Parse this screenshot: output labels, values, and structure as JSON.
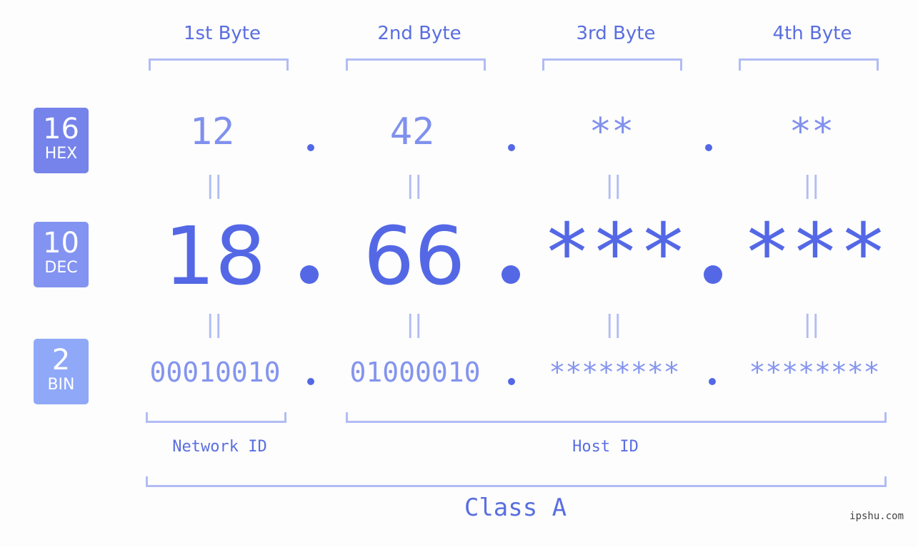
{
  "bytes": [
    {
      "title": "1st Byte",
      "hex": "12",
      "dec": "18",
      "bin": "00010010"
    },
    {
      "title": "2nd Byte",
      "hex": "42",
      "dec": "66",
      "bin": "01000010"
    },
    {
      "title": "3rd Byte",
      "hex": "**",
      "dec": "***",
      "bin": "********"
    },
    {
      "title": "4th Byte",
      "hex": "**",
      "dec": "***",
      "bin": "********"
    }
  ],
  "badges": {
    "hex": {
      "num": "16",
      "label": "HEX",
      "color": "#7583ea"
    },
    "dec": {
      "num": "10",
      "label": "DEC",
      "color": "#8393f1"
    },
    "bin": {
      "num": "2",
      "label": "BIN",
      "color": "#8fa8f8"
    }
  },
  "equals_symbol": "||",
  "network_id_label": "Network ID",
  "host_id_label": "Host ID",
  "class_label": "Class A",
  "watermark": "ipshu.com",
  "colors": {
    "accent": "#5468e6",
    "light": "#b1bcf5"
  }
}
